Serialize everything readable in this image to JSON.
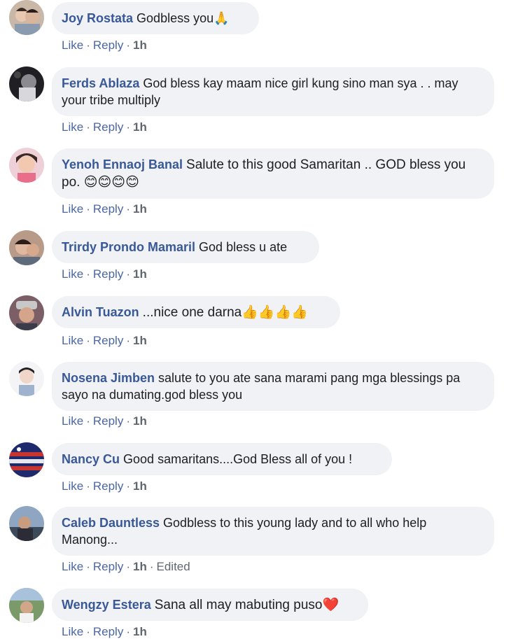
{
  "actions": {
    "like": "Like",
    "reply": "Reply",
    "separator": "·"
  },
  "comments": [
    {
      "name": "Joy Rostata",
      "text": "Godbless you🙏",
      "time": "1h"
    },
    {
      "name": "Ferds Ablaza",
      "text": "God bless kay maam nice girl kung sino man sya . . may your tribe multiply",
      "time": "1h"
    },
    {
      "name": "Yenoh Ennaoj Banal",
      "text": "Salute to this good Samaritan .. GOD bless you po. 😊😊😊😊",
      "time": "1h"
    },
    {
      "name": "Trirdy Prondo Mamaril",
      "text": "God bless u ate",
      "time": "1h"
    },
    {
      "name": "Alvin Tuazon",
      "text": "...nice one darna👍👍👍👍",
      "time": "1h"
    },
    {
      "name": "Nosena Jimben",
      "text": "salute to you ate sana marami pang mga blessings pa sayo na dumating.god bless you",
      "time": "1h"
    },
    {
      "name": "Nancy Cu",
      "text": "Good samaritans....God Bless all of you !",
      "time": "1h"
    },
    {
      "name": "Caleb Dauntless",
      "text": "Godbless to this young lady and to all who help Manong...",
      "time": "1h",
      "edited": "Edited"
    },
    {
      "name": "Wengzy Estera",
      "text": "Sana all may mabuting puso❤️",
      "time": "1h"
    }
  ],
  "colors": {
    "name": "#385898",
    "bubble": "#f0f2f5",
    "action": "#4b67a1",
    "meta": "#606770"
  }
}
